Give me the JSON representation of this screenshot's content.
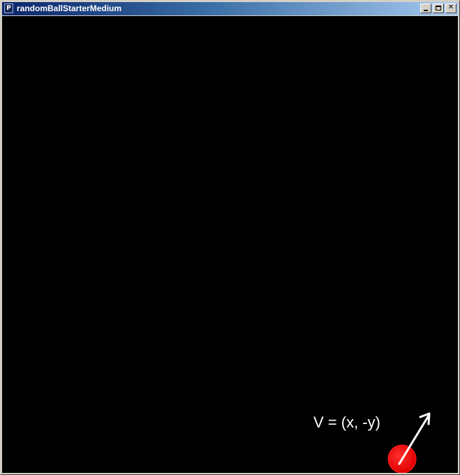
{
  "window": {
    "title": "randomBallStarterMedium",
    "app_icon_glyph": "P",
    "buttons": {
      "minimize": "minimize",
      "maximize": "maximize",
      "close_glyph": "✕"
    }
  },
  "canvas": {
    "background": "#000000",
    "velocity_label": "V = (x, -y)",
    "ball_color": "#ff0000",
    "arrow_color": "#ffffff"
  }
}
